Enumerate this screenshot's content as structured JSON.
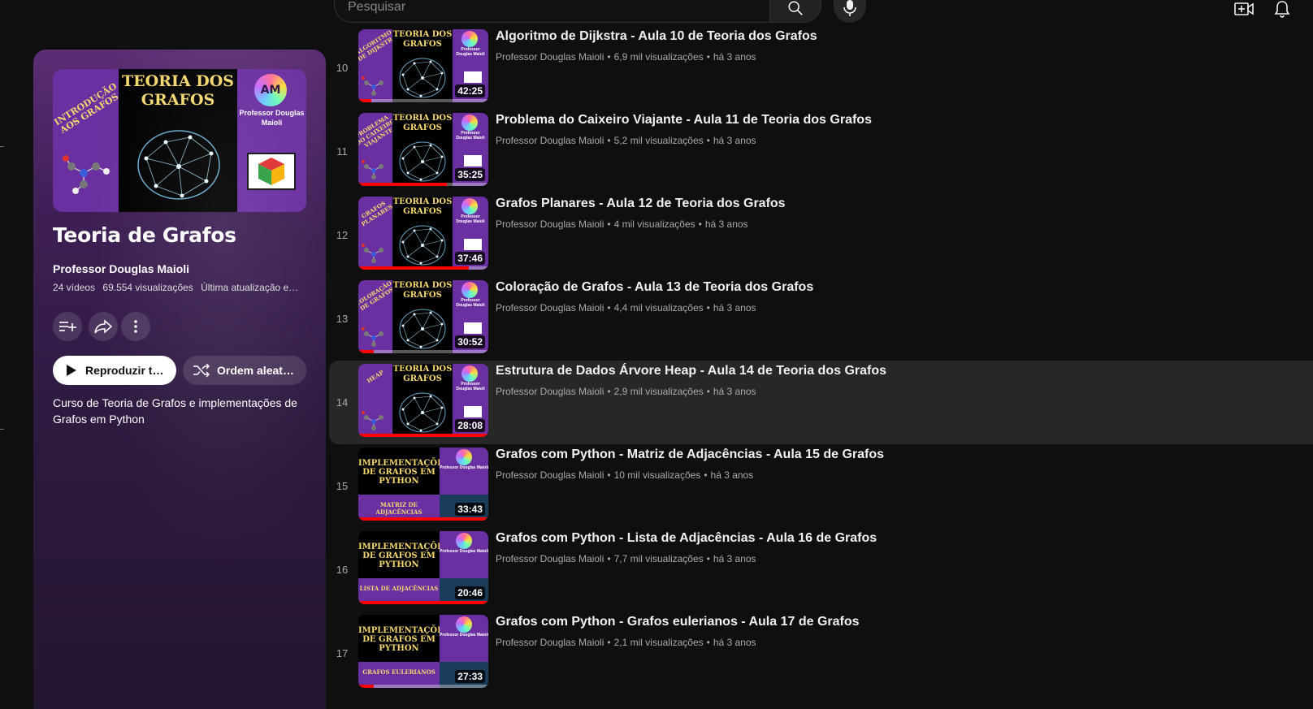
{
  "search": {
    "placeholder": "Pesquisar"
  },
  "playlist": {
    "cover_title": "TEORIA DOS GRAFOS",
    "cover_subtitle": "INTRODUÇÃO AOS GRAFOS",
    "cover_channel": "Professor Douglas Maioli",
    "cover_logo": "AM",
    "title": "Teoria de Grafos",
    "owner": "Professor Douglas Maioli",
    "videos_count": "24 vídeos",
    "views": "69.554 visualizações",
    "updated": "Última atualização em...",
    "play_all_label": "Reproduzir tu...",
    "shuffle_label": "Ordem aleató...",
    "description": "Curso de Teoria de Grafos e implementações de Grafos em Python"
  },
  "videos": [
    {
      "index": "10",
      "title": "Algoritmo de Dijkstra - Aula 10 de Teoria dos Grafos",
      "channel": "Professor Douglas Maioli",
      "views": "6,9 mil visualizações",
      "age": "há 3 anos",
      "duration": "42:25",
      "thumb_sub": "ALGORITMO DE DIJKSTRA",
      "progress": 0.1
    },
    {
      "index": "11",
      "title": "Problema do Caixeiro Viajante - Aula 11 de Teoria dos Grafos",
      "channel": "Professor Douglas Maioli",
      "views": "5,2 mil visualizações",
      "age": "há 3 anos",
      "duration": "35:25",
      "thumb_sub": "PROBLEMA DO CAIXEIRO VIAJANTE",
      "progress": 0.68
    },
    {
      "index": "12",
      "title": "Grafos Planares - Aula 12 de Teoria dos Grafos",
      "channel": "Professor Douglas Maioli",
      "views": "4 mil visualizações",
      "age": "há 3 anos",
      "duration": "37:46",
      "thumb_sub": "GRAFOS PLANARES",
      "progress": 0.85
    },
    {
      "index": "13",
      "title": "Coloração de Grafos - Aula 13 de Teoria dos Grafos",
      "channel": "Professor Douglas Maioli",
      "views": "4,4 mil visualizações",
      "age": "há 3 anos",
      "duration": "30:52",
      "thumb_sub": "COLORAÇÃO DE GRAFOS",
      "progress": 0.12
    },
    {
      "index": "14",
      "title": "Estrutura de Dados Árvore Heap - Aula 14 de Teoria dos Grafos",
      "channel": "Professor Douglas Maioli",
      "views": "2,9 mil visualizações",
      "age": "há 3 anos",
      "duration": "28:08",
      "thumb_sub": "HEAP",
      "progress": 1.0
    },
    {
      "index": "15",
      "title": "Grafos com Python - Matriz de Adjacências - Aula 15 de Grafos",
      "channel": "Professor Douglas Maioli",
      "views": "10 mil visualizações",
      "age": "há 3 anos",
      "duration": "33:43",
      "thumb_sub": "MATRIZ DE ADJACÊNCIAS",
      "progress": 1.0
    },
    {
      "index": "16",
      "title": "Grafos com Python - Lista de Adjacências - Aula 16 de Grafos",
      "channel": "Professor Douglas Maioli",
      "views": "7,7 mil visualizações",
      "age": "há 3 anos",
      "duration": "20:46",
      "thumb_sub": "LISTA DE ADJACÊNCIAS",
      "progress": 1.0
    },
    {
      "index": "17",
      "title": "Grafos com Python - Grafos eulerianos - Aula 17 de Grafos",
      "channel": "Professor Douglas Maioli",
      "views": "2,1 mil visualizações",
      "age": "há 3 anos",
      "duration": "27:33",
      "thumb_sub": "GRAFOS EULERIANOS",
      "progress": 0.12
    }
  ],
  "thumb_text": {
    "brain_title": "TEORIA DOS GRAFOS",
    "python_title": "IMPLEMENTAÇÕES DE GRAFOS EM PYTHON",
    "channel_short": "Professor Douglas Maioli"
  },
  "colors": {
    "accent_red": "#ff0000",
    "purple": "#6a2fa0",
    "gold": "#f5d76e"
  },
  "icons": {
    "search": "search-icon",
    "mic": "mic-icon",
    "create": "create-video-icon",
    "bell": "bell-icon",
    "save": "add-to-queue-icon",
    "share": "share-icon",
    "more": "more-vert-icon",
    "play": "play-icon",
    "shuffle": "shuffle-icon"
  },
  "highlight_index": "14"
}
